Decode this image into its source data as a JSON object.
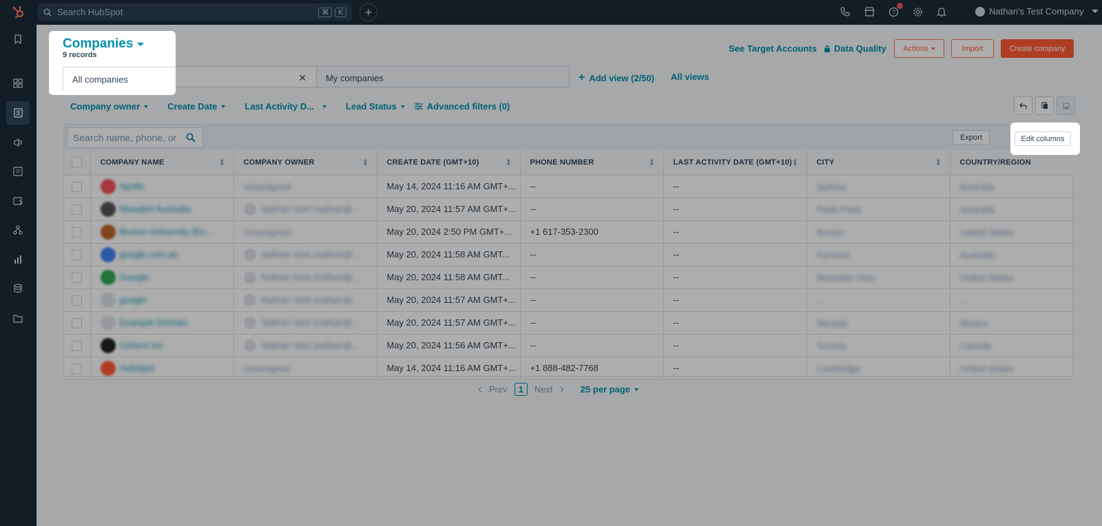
{
  "topbar": {
    "search_placeholder": "Search HubSpot",
    "kbd1": "⌘",
    "kbd2": "K",
    "account_name": "Nathan's Test Company"
  },
  "header": {
    "title": "Companies",
    "records": "9 records",
    "see_target": "See Target Accounts",
    "data_quality": "Data Quality",
    "actions": "Actions",
    "import": "Import",
    "create": "Create company"
  },
  "views": {
    "all": "All companies",
    "my": "My companies",
    "add_view": "Add view (2/50)",
    "all_views": "All views"
  },
  "filters": {
    "owner": "Company owner",
    "create_date": "Create Date",
    "last_activity": "Last Activity D...",
    "lead_status": "Lead Status",
    "advanced": "Advanced filters (0)"
  },
  "table": {
    "search_placeholder": "Search name, phone, or",
    "export": "Export",
    "edit_columns": "Edit columns",
    "columns": [
      "COMPANY NAME",
      "COMPANY OWNER",
      "CREATE DATE (GMT+10)",
      "PHONE NUMBER",
      "LAST ACTIVITY DATE (GMT+10)",
      "CITY",
      "COUNTRY/REGION"
    ],
    "rows": [
      {
        "name": "Apollo",
        "owner": "Unassigned",
        "date": "May 14, 2024 11:16 AM GMT+...",
        "phone": "--",
        "activity": "--",
        "city": "Sydney",
        "country": "Australia"
      },
      {
        "name": "Maxalert Australia",
        "owner": "Nathan Vant (nathan@...",
        "date": "May 20, 2024 11:57 AM GMT+...",
        "phone": "--",
        "activity": "--",
        "city": "Perth Point",
        "country": "Australia"
      },
      {
        "name": "Boston University (Es...",
        "owner": "Unassigned",
        "date": "May 20, 2024 2:50 PM GMT+...",
        "phone": "+1 617-353-2300",
        "activity": "--",
        "city": "Boston",
        "country": "United States"
      },
      {
        "name": "google.com.au",
        "owner": "Nathan Vant (nathan@...",
        "date": "May 20, 2024 11:58 AM GMT...",
        "phone": "--",
        "activity": "--",
        "city": "Pyrmont",
        "country": "Australia"
      },
      {
        "name": "Google",
        "owner": "Nathan Vant (nathan@...",
        "date": "May 20, 2024 11:58 AM GMT...",
        "phone": "--",
        "activity": "--",
        "city": "Mountain View",
        "country": "United States"
      },
      {
        "name": "google",
        "owner": "Nathan Vant (nathan@...",
        "date": "May 20, 2024 11:57 AM GMT+...",
        "phone": "--",
        "activity": "--",
        "city": "--",
        "country": "--"
      },
      {
        "name": "Example Domain",
        "owner": "Nathan Vant (nathan@...",
        "date": "May 20, 2024 11:57 AM GMT+...",
        "phone": "--",
        "activity": "--",
        "city": "Nevada",
        "country": "Mexico"
      },
      {
        "name": "Cohere Inc",
        "owner": "Nathan Vant (nathan@...",
        "date": "May 20, 2024 11:56 AM GMT+...",
        "phone": "--",
        "activity": "--",
        "city": "Toronto",
        "country": "Canada"
      },
      {
        "name": "HubSpot",
        "owner": "Unassigned",
        "date": "May 14, 2024 11:16 AM GMT+...",
        "phone": "+1 888-482-7768",
        "activity": "--",
        "city": "Cambridge",
        "country": "United States"
      }
    ],
    "avatar_colors": [
      "#f2545b",
      "#555",
      "#c0652b",
      "#4285f4",
      "#34a853",
      "#dfe3eb",
      "#dfe3eb",
      "#222",
      "#ff5c35"
    ]
  },
  "pager": {
    "prev": "Prev",
    "page": "1",
    "next": "Next",
    "per_page": "25 per page"
  },
  "colors": {
    "accent": "#0091ae",
    "brand": "#ff5c35",
    "nav": "#1d2b39"
  }
}
